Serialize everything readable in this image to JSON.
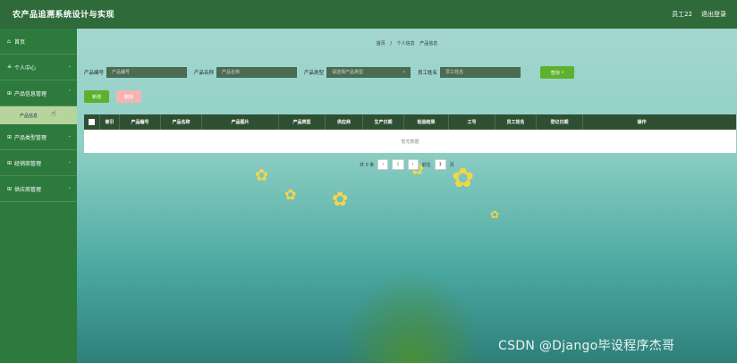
{
  "header": {
    "title": "农产品追溯系统设计与实现",
    "user": "员工22",
    "logout": "退出登录"
  },
  "sidebar": {
    "items": [
      {
        "label": "首页",
        "icon": "home-icon"
      },
      {
        "label": "个人中心",
        "icon": "person-icon"
      },
      {
        "label": "产品信息管理",
        "icon": "grid-icon"
      },
      {
        "label": "产品类型管理",
        "icon": "grid-icon"
      },
      {
        "label": "经销商管理",
        "icon": "grid-icon"
      },
      {
        "label": "供应商管理",
        "icon": "grid-icon"
      }
    ],
    "sub_item": "产品信息"
  },
  "breadcrumb": {
    "home": "首页",
    "sep": "/",
    "personal": "个人信息",
    "current": "产品信息"
  },
  "filters": {
    "code_label": "产品编号",
    "code_placeholder": "产品编号",
    "name_label": "产品名称",
    "name_placeholder": "产品名称",
    "type_label": "产品类型",
    "type_placeholder": "请选择产品类型",
    "staff_label": "员工姓名",
    "staff_placeholder": "员工姓名",
    "search_label": "查询"
  },
  "actions": {
    "add": "新增",
    "delete": "删除"
  },
  "table": {
    "columns": [
      "索引",
      "产品编号",
      "产品名称",
      "产品图片",
      "产品类型",
      "供应商",
      "生产日期",
      "检验结果",
      "工号",
      "员工姓名",
      "登记日期",
      "操作"
    ],
    "empty": "暂无数据"
  },
  "pagination": {
    "total": "共 0 条",
    "page": "1",
    "goto": "前往",
    "goto_page": "1",
    "page_unit": "页"
  },
  "watermark": "CSDN @Django毕设程序杰哥"
}
